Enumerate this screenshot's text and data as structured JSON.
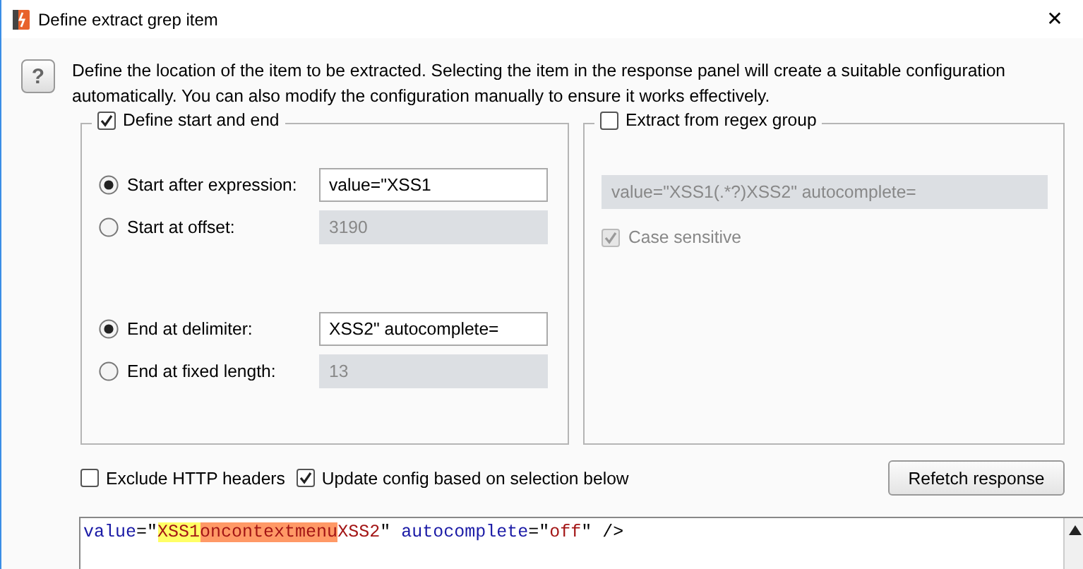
{
  "window": {
    "title": "Define extract grep item",
    "close": "✕"
  },
  "help": {
    "icon": "?",
    "text": "Define the location of the item to be extracted. Selecting the item in the response panel will create a suitable configuration automatically. You can also modify the configuration manually to ensure it works effectively."
  },
  "start_end": {
    "label": "Define start and end",
    "checked": true,
    "options": [
      {
        "label": "Start after expression:",
        "selected": true,
        "value": "value=\"XSS1",
        "disabled": false
      },
      {
        "label": "Start at offset:",
        "selected": false,
        "value": "3190",
        "disabled": true
      },
      {
        "label": "End at delimiter:",
        "selected": true,
        "value": "XSS2\" autocomplete=",
        "disabled": false
      },
      {
        "label": "End at fixed length:",
        "selected": false,
        "value": "13",
        "disabled": true
      }
    ]
  },
  "regex_group": {
    "label": "Extract from regex group",
    "checked": false,
    "value": "value=\"XSS1(.*?)XSS2\" autocomplete=",
    "case_sensitive": {
      "label": "Case sensitive",
      "checked": true,
      "disabled": true
    }
  },
  "options": [
    {
      "label": "Exclude HTTP headers",
      "checked": false
    },
    {
      "label": "Update config based on selection below",
      "checked": true
    }
  ],
  "refetch_button": "Refetch response",
  "response": [
    {
      "text": "value",
      "color": "#1a1aa6"
    },
    {
      "text": "=\"",
      "color": "#000000"
    },
    {
      "text": "XSS1",
      "kind": "highlight",
      "color": "#ffff66"
    },
    {
      "text": "oncontextmenu",
      "kind": "highlight",
      "color": "#ff9966"
    },
    {
      "text": "XSS2",
      "color": "#a31515"
    },
    {
      "text": "\" ",
      "color": "#000000"
    },
    {
      "text": "autocomplete",
      "color": "#1a1aa6"
    },
    {
      "text": "=\"",
      "color": "#000000"
    },
    {
      "text": "off",
      "color": "#a31515"
    },
    {
      "text": "\" />",
      "color": "#000000"
    }
  ]
}
